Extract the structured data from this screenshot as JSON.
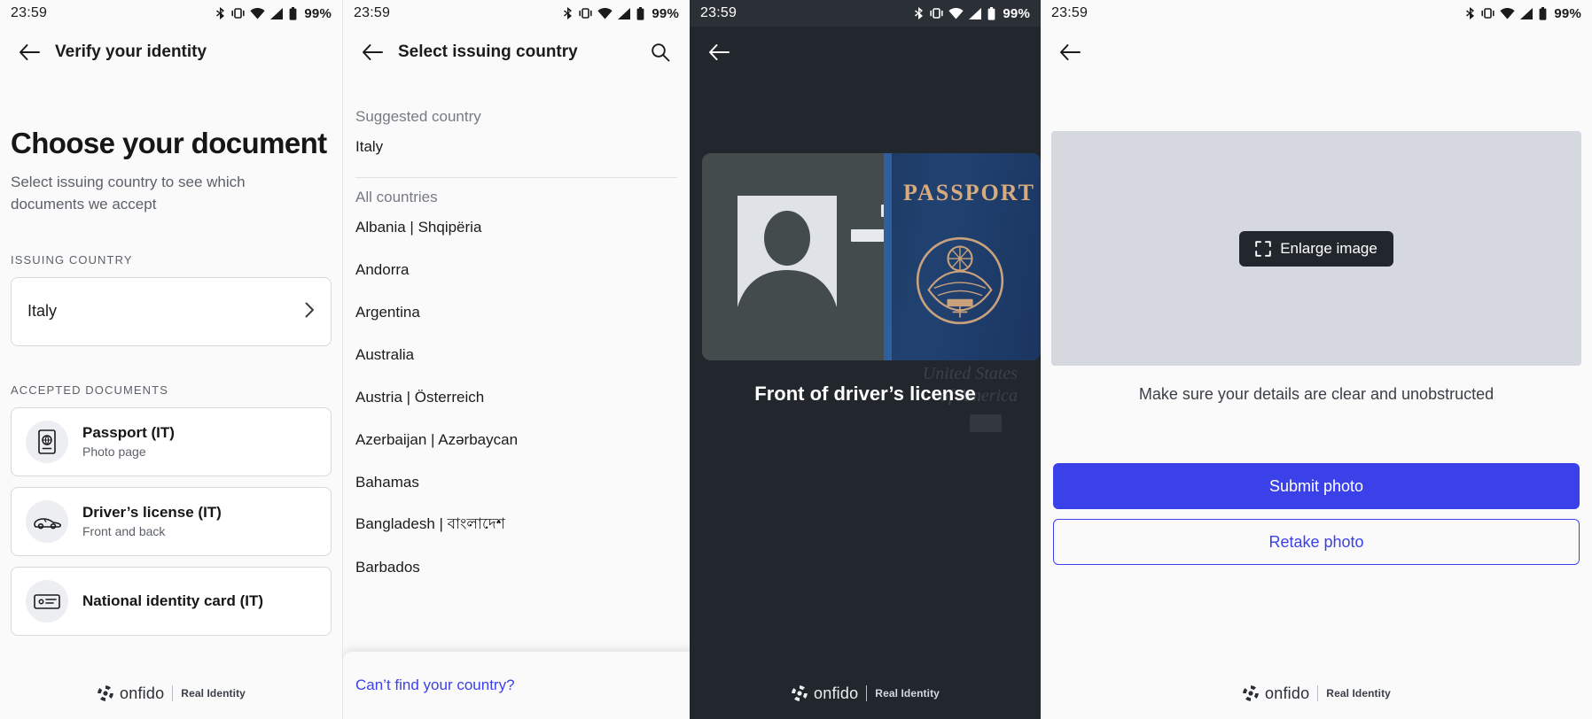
{
  "status_bar": {
    "time": "23:59",
    "battery": "99%",
    "icons": [
      "bluetooth-icon",
      "vibrate-icon",
      "wifi-icon",
      "signal-icon",
      "battery-icon"
    ]
  },
  "screen1": {
    "appbar_title": "Verify your identity",
    "heading": "Choose your document",
    "subtitle": "Select issuing country to see which documents we accept",
    "issuing_country_label": "ISSUING COUNTRY",
    "issuing_country_value": "Italy",
    "accepted_documents_label": "ACCEPTED DOCUMENTS",
    "documents": [
      {
        "title": "Passport (IT)",
        "subtitle": "Photo page",
        "icon": "passport-icon"
      },
      {
        "title": "Driver’s license (IT)",
        "subtitle": "Front and back",
        "icon": "car-icon"
      },
      {
        "title": "National identity card (IT)",
        "subtitle": "",
        "icon": "id-card-icon"
      }
    ]
  },
  "screen2": {
    "appbar_title": "Select issuing country",
    "search_icon": "search-icon",
    "suggested_label": "Suggested country",
    "suggested": [
      "Italy"
    ],
    "all_label": "All countries",
    "countries": [
      "Albania | Shqipëria",
      "Andorra",
      "Argentina",
      "Australia",
      "Austria | Österreich",
      "Azerbaijan | Azərbaycan",
      "Bahamas",
      "Bangladesh | বাংলাদেশ",
      "Barbados"
    ],
    "cant_find_link": "Can’t find your country?"
  },
  "screen3": {
    "caption": "Front of driver’s license",
    "passport_word": "PASSPORT",
    "usa_text_line1": "United States",
    "usa_text_line2": "of America"
  },
  "screen4": {
    "enlarge_label": "Enlarge image",
    "enlarge_icon": "expand-icon",
    "hint": "Make sure your details are clear and unobstructed",
    "submit_label": "Submit photo",
    "retake_label": "Retake photo"
  },
  "footer": {
    "brand": "onfido",
    "tagline": "Real Identity",
    "logo_icon": "onfido-logo-icon"
  },
  "colors": {
    "accent_blue": "#3b41e8",
    "dark_bg": "#22262d",
    "page_bg": "#fafafa",
    "preview_gray": "#d5d8de"
  }
}
